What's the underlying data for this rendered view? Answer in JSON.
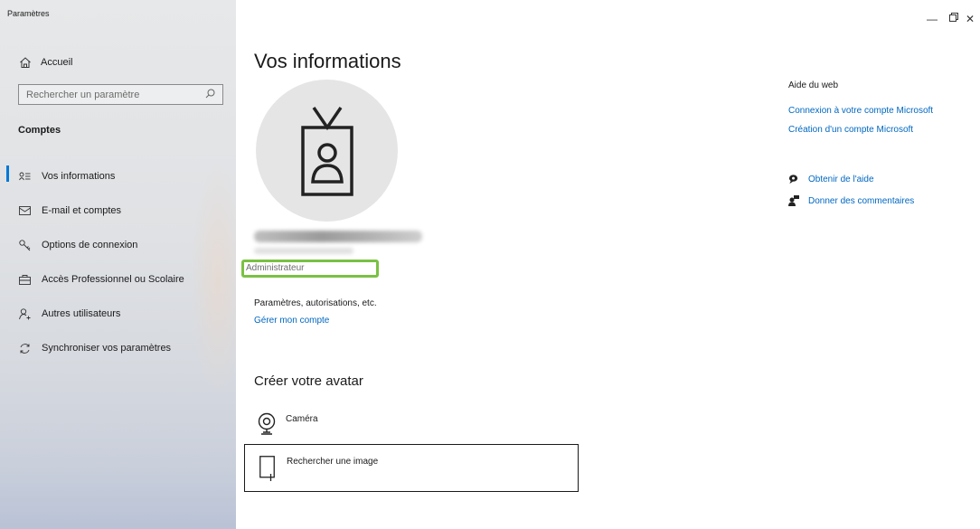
{
  "window": {
    "title": "Paramètres",
    "minimize": "—",
    "maximize": "▭",
    "close": "✕"
  },
  "sidebar": {
    "home_label": "Accueil",
    "search_placeholder": "Rechercher un paramètre",
    "section_title": "Comptes",
    "items": [
      {
        "label": "Vos informations",
        "icon": "person-list-icon",
        "active": true
      },
      {
        "label": "E-mail et comptes",
        "icon": "mail-icon"
      },
      {
        "label": "Options de connexion",
        "icon": "key-icon"
      },
      {
        "label": "Accès Professionnel ou Scolaire",
        "icon": "briefcase-icon"
      },
      {
        "label": "Autres utilisateurs",
        "icon": "add-person-icon"
      },
      {
        "label": "Synchroniser vos paramètres",
        "icon": "sync-icon"
      }
    ]
  },
  "main": {
    "title": "Vos informations",
    "role": "Administrateur",
    "permissions_text": "Paramètres, autorisations, etc.",
    "manage_link": "Gérer mon compte",
    "avatar_section_title": "Créer votre avatar",
    "camera_label": "Caméra",
    "browse_label": "Rechercher une image"
  },
  "help": {
    "title": "Aide du web",
    "links": [
      "Connexion à votre compte Microsoft",
      "Création d'un compte Microsoft"
    ],
    "get_help": "Obtenir de l'aide",
    "feedback": "Donner des commentaires"
  },
  "colors": {
    "accent": "#0078d7",
    "link": "#0067c0",
    "highlight": "#7ac143"
  }
}
